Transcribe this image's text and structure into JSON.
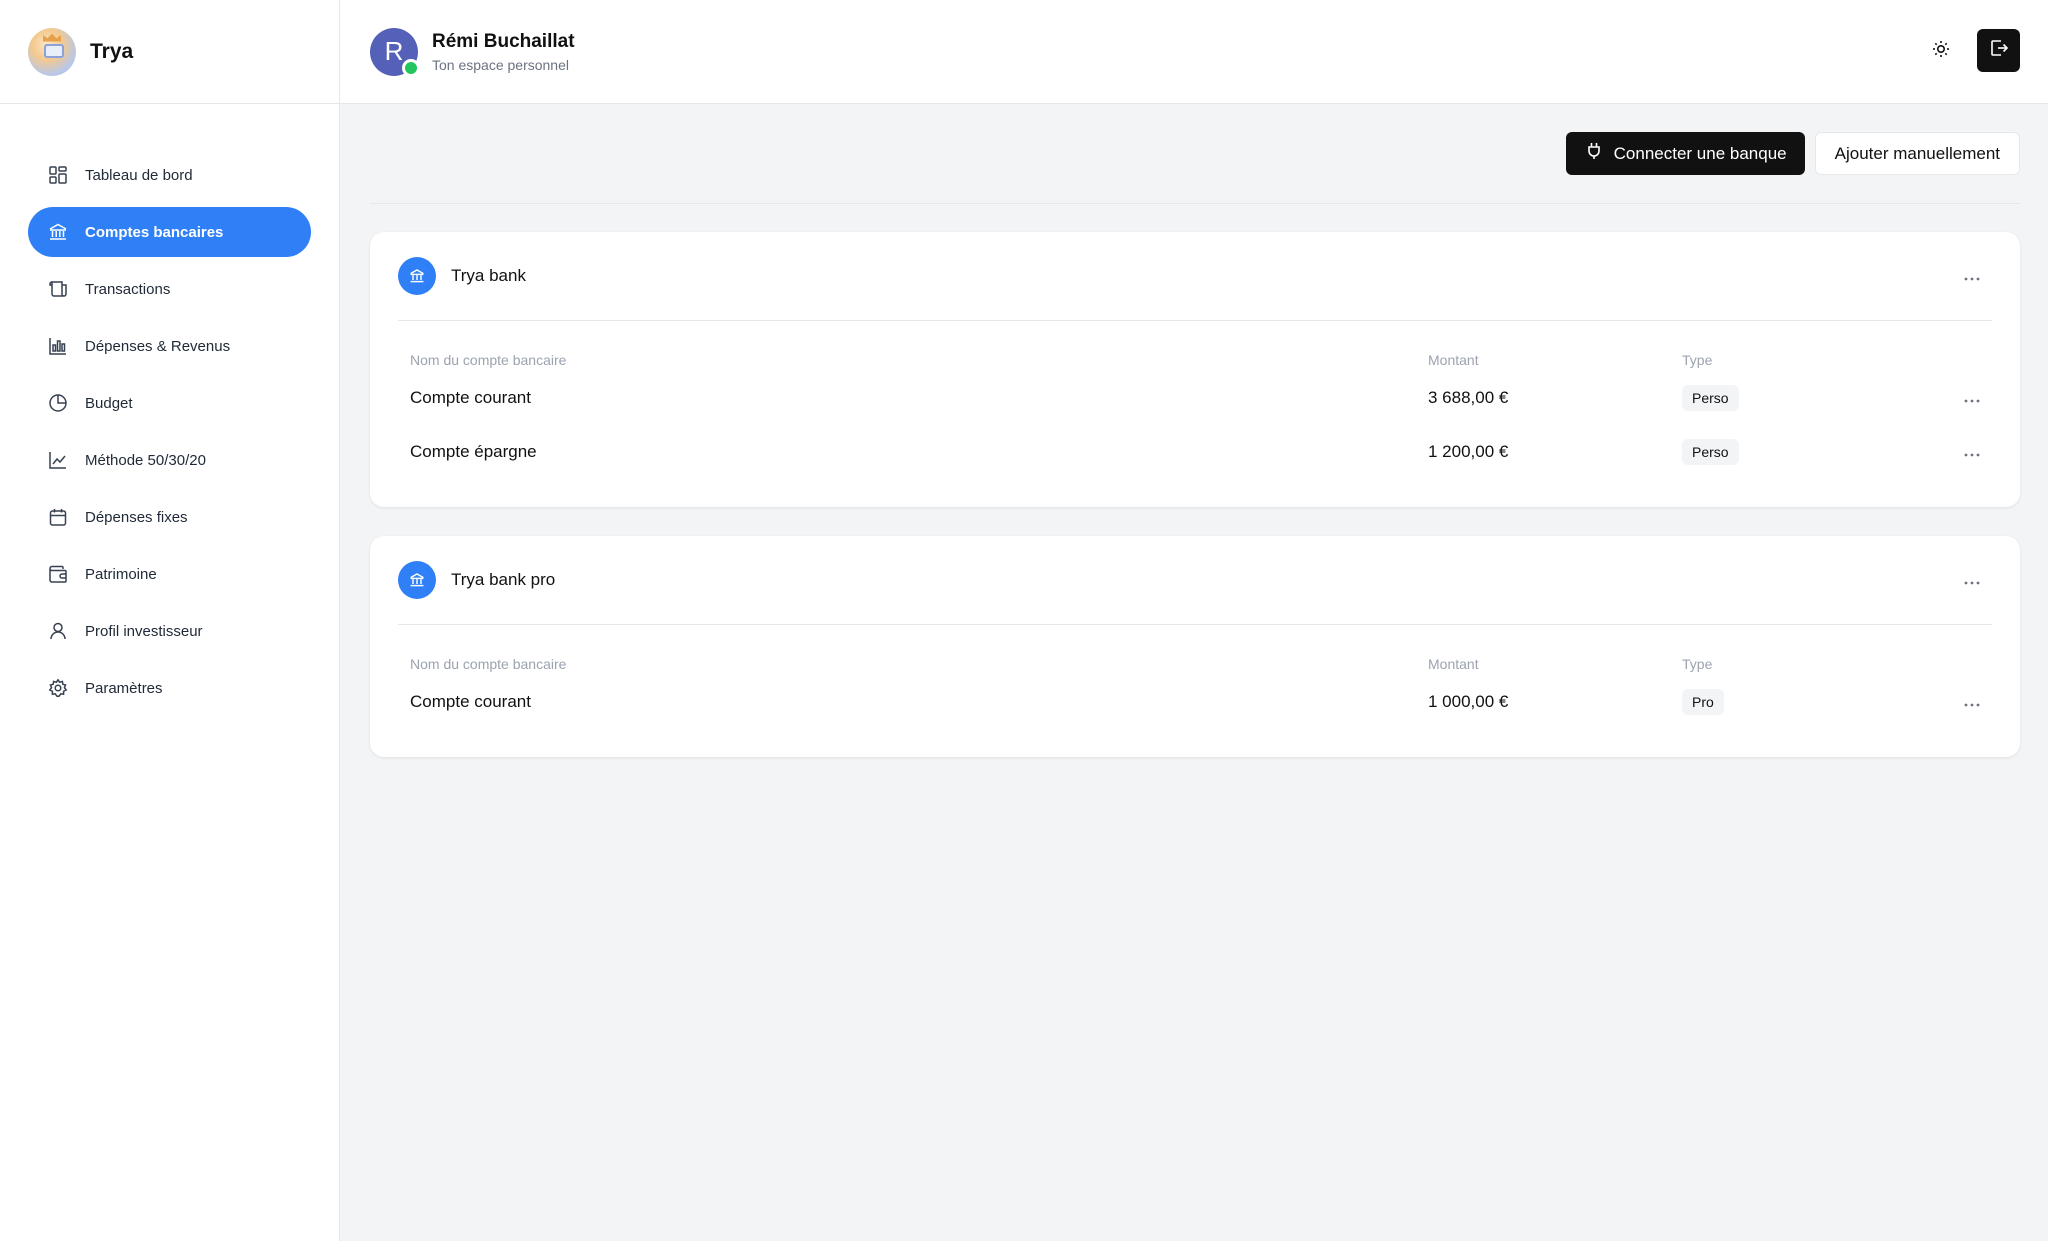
{
  "brand": {
    "name": "Trya"
  },
  "sidebar": {
    "items": [
      {
        "label": "Tableau de bord",
        "icon": "dashboard-icon",
        "active": false
      },
      {
        "label": "Comptes bancaires",
        "icon": "bank-icon",
        "active": true
      },
      {
        "label": "Transactions",
        "icon": "receipt-icon",
        "active": false
      },
      {
        "label": "Dépenses & Revenus",
        "icon": "bar-chart-icon",
        "active": false
      },
      {
        "label": "Budget",
        "icon": "pie-chart-icon",
        "active": false
      },
      {
        "label": "Méthode 50/30/20",
        "icon": "line-chart-icon",
        "active": false
      },
      {
        "label": "Dépenses fixes",
        "icon": "calendar-icon",
        "active": false
      },
      {
        "label": "Patrimoine",
        "icon": "wallet-icon",
        "active": false
      },
      {
        "label": "Profil investisseur",
        "icon": "user-icon",
        "active": false
      },
      {
        "label": "Paramètres",
        "icon": "gear-icon",
        "active": false
      }
    ]
  },
  "header": {
    "avatar_initial": "R",
    "user_name": "Rémi Buchaillat",
    "subtitle": "Ton espace personnel"
  },
  "actions": {
    "connect_label": "Connecter une banque",
    "add_manual_label": "Ajouter manuellement"
  },
  "columns": {
    "name": "Nom du compte bancaire",
    "amount": "Montant",
    "type": "Type"
  },
  "banks": [
    {
      "name": "Trya bank",
      "accounts": [
        {
          "name": "Compte courant",
          "amount": "3 688,00 €",
          "type": "Perso"
        },
        {
          "name": "Compte épargne",
          "amount": "1 200,00 €",
          "type": "Perso"
        }
      ]
    },
    {
      "name": "Trya bank pro",
      "accounts": [
        {
          "name": "Compte courant",
          "amount": "1 000,00 €",
          "type": "Pro"
        }
      ]
    }
  ],
  "colors": {
    "accent": "#2f80f7",
    "dark": "#111111",
    "online": "#22c55e",
    "avatar": "#5560b8"
  }
}
